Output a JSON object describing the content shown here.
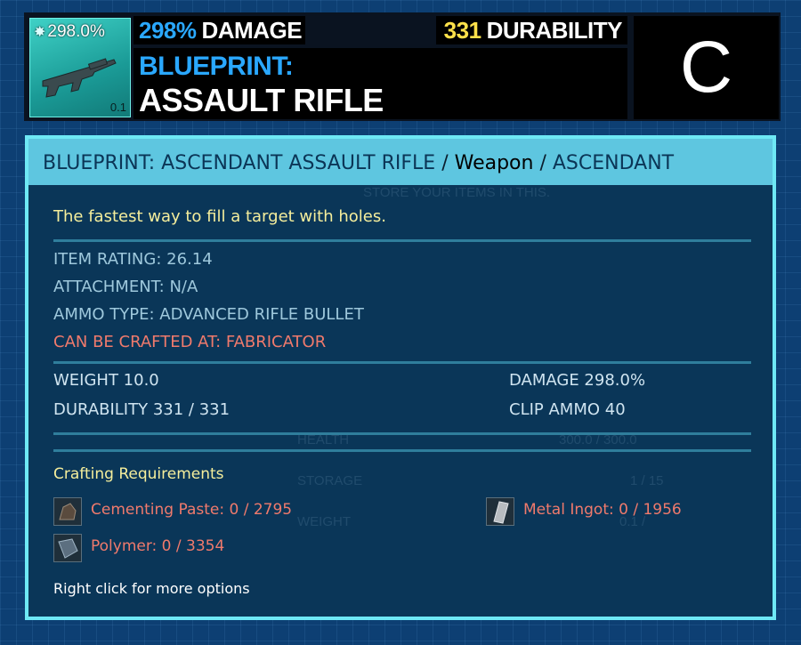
{
  "item": {
    "damage_percent_badge": "298.0%",
    "quantity": "0.1",
    "damage_value": "298%",
    "damage_label": "DAMAGE",
    "durability_value": "331",
    "durability_label": "DURABILITY",
    "blueprint_label": "BLUEPRINT:",
    "name": "ASSAULT RIFLE",
    "quality_grade": "C"
  },
  "panel": {
    "header_title": "BLUEPRINT: ASCENDANT ASSAULT RIFLE",
    "header_sep1": " / ",
    "header_type": "Weapon",
    "header_sep2": " / ",
    "header_quality": "ASCENDANT",
    "description": "The fastest way to fill a target with holes.",
    "stats": {
      "item_rating": "ITEM RATING: 26.14",
      "attachment": "ATTACHMENT: N/A",
      "ammo_type": "AMMO TYPE: ADVANCED RIFLE BULLET",
      "crafted_at": "CAN BE CRAFTED AT: FABRICATOR",
      "weight": "WEIGHT 10.0",
      "damage": "DAMAGE 298.0%",
      "durability": "DURABILITY 331 / 331",
      "clip_ammo": "CLIP AMMO 40"
    },
    "crafting_title": "Crafting Requirements",
    "requirements": [
      {
        "label": "Cementing Paste: 0 / 2795",
        "icon": "cementing-paste-icon"
      },
      {
        "label": "Metal Ingot: 0 / 1956",
        "icon": "metal-ingot-icon"
      },
      {
        "label": "Polymer: 0 / 3354",
        "icon": "polymer-icon"
      }
    ],
    "hint": "Right click for more options"
  },
  "background_ghost": {
    "store_text": "STORE YOUR ITEMS IN THIS.",
    "health": "HEALTH",
    "health_value": "300.0 / 300.0",
    "storage": "STORAGE",
    "storage_value": "1 / 15",
    "weight": "WEIGHT",
    "weight_value": "0.1 /"
  },
  "colors": {
    "accent_blue": "#2aa8ff",
    "durability_yellow": "#ffe14a",
    "panel_border": "#6ee8f5",
    "warning_red": "#f07a6c",
    "description_yellow": "#f5ee9c"
  }
}
